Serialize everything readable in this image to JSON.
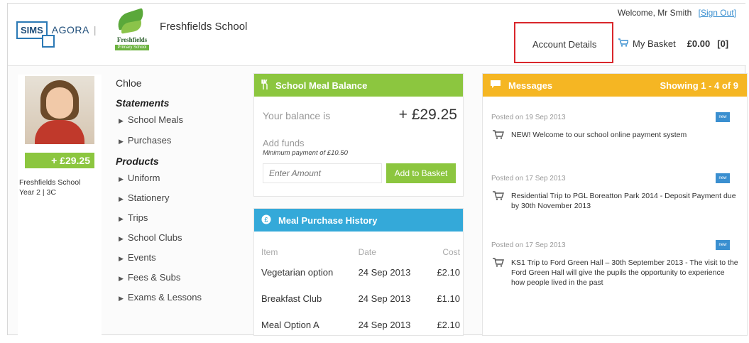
{
  "header": {
    "brand_sims": "SIMS",
    "brand_agora": "AGORA",
    "brand_separator": "|",
    "school_logo_name": "Freshfields",
    "school_logo_tagline": "Primary School",
    "school_name": "Freshfields School",
    "welcome_text": "Welcome, Mr Smith",
    "sign_out_label": "[Sign Out]",
    "account_details_label": "Account Details",
    "basket_label": "My Basket",
    "basket_amount": "£0.00",
    "basket_count": "[0]"
  },
  "child": {
    "name": "Chloe",
    "balance": "+ £29.25",
    "school": "Freshfields School",
    "year_class": "Year 2 | 3C"
  },
  "nav": {
    "statements_heading": "Statements",
    "statements": [
      "School Meals",
      "Purchases"
    ],
    "products_heading": "Products",
    "products": [
      "Uniform",
      "Stationery",
      "Trips",
      "School Clubs",
      "Events",
      "Fees & Subs",
      "Exams & Lessons"
    ]
  },
  "meal_balance": {
    "title": "School Meal Balance",
    "balance_label": "Your balance is",
    "balance_value": "+ £29.25",
    "add_funds_label": "Add funds",
    "minimum_payment": "Minimum payment of £10.50",
    "amount_placeholder": "Enter Amount",
    "add_button": "Add to Basket"
  },
  "meal_history": {
    "title": "Meal Purchase History",
    "columns": [
      "Item",
      "Date",
      "Cost"
    ],
    "rows": [
      [
        "Vegetarian option",
        "24 Sep 2013",
        "£2.10"
      ],
      [
        "Breakfast Club",
        "24 Sep 2013",
        "£1.10"
      ],
      [
        "Meal Option A",
        "24 Sep 2013",
        "£2.10"
      ]
    ]
  },
  "messages": {
    "title": "Messages",
    "showing": "Showing 1 - 4 of 9",
    "new_badge": "new",
    "items": [
      {
        "posted": "Posted on 19 Sep 2013",
        "text": "NEW! Welcome to our school online payment system"
      },
      {
        "posted": "Posted on 17 Sep 2013",
        "text": "Residential Trip to PGL Boreatton Park 2014 - Deposit Payment due by 30th November 2013"
      },
      {
        "posted": "Posted on 17 Sep 2013",
        "text": "KS1 Trip to Ford Green Hall – 30th September 2013 - The visit to the Ford Green Hall will give the pupils the opportunity to experience how people lived in the past"
      }
    ]
  },
  "colors": {
    "green": "#8cc63f",
    "blue": "#34a9d9",
    "orange": "#f5b623",
    "highlight_red": "#d9262b"
  },
  "icons": {
    "meal_balance_icon": "cutlery-icon",
    "meal_history_icon": "coin-icon",
    "messages_icon": "speech-bubble-icon",
    "basket_icon": "cart-icon"
  }
}
